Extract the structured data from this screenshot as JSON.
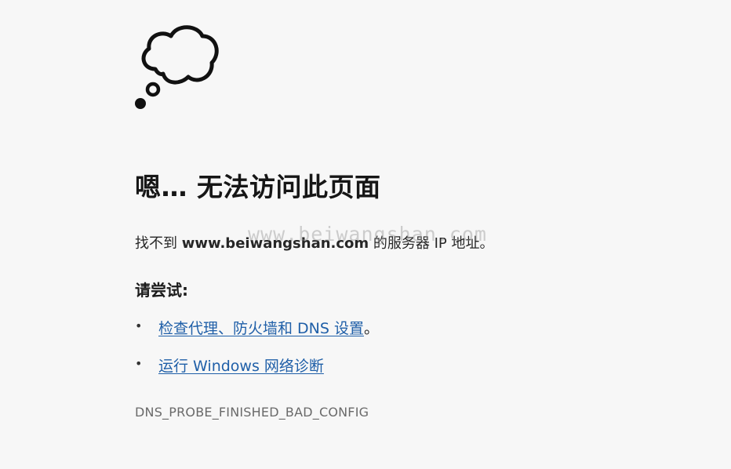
{
  "icon": {
    "name": "thought-cloud-icon"
  },
  "title": "嗯… 无法访问此页面",
  "description": {
    "prefix": "找不到 ",
    "host": "www.beiwangshan.com",
    "suffix": " 的服务器 IP 地址。"
  },
  "watermark": "www.beiwangshan.com",
  "try_heading": "请尝试:",
  "suggestions": [
    {
      "bullet": "•",
      "label": "检查代理、防火墙和 DNS 设置",
      "trailing": "。"
    },
    {
      "bullet": "•",
      "label": "运行 Windows 网络诊断",
      "trailing": ""
    }
  ],
  "error_code": "DNS_PROBE_FINISHED_BAD_CONFIG",
  "colors": {
    "background": "#f7f7f7",
    "link": "#1f5fa8",
    "error_code": "#6a6a6a"
  }
}
